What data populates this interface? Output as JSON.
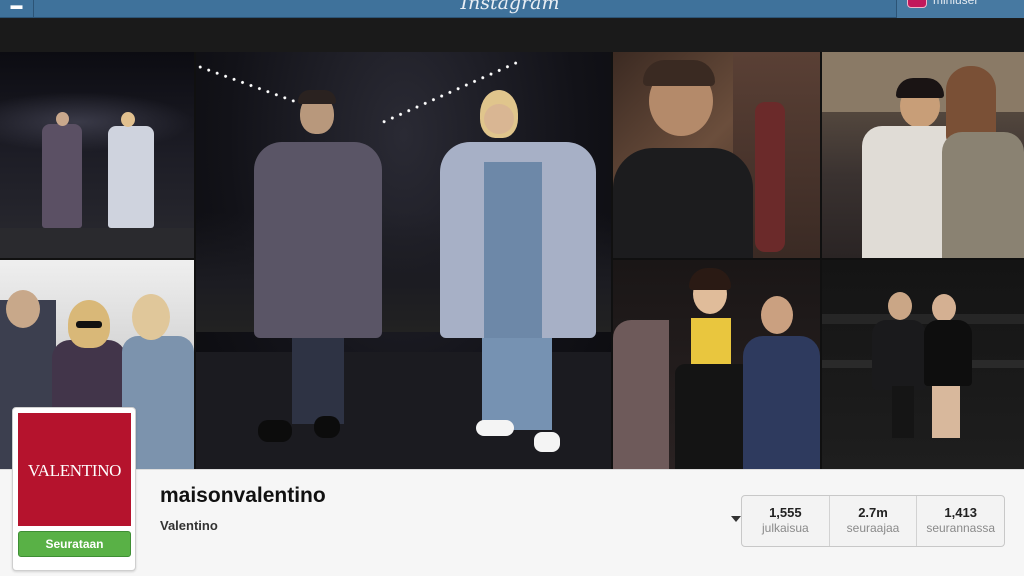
{
  "topbar": {
    "logo_text": "Instagram",
    "menu_icon": "menu-icon",
    "username": "miniuser"
  },
  "profile": {
    "username": "maisonvalentino",
    "full_name": "Valentino",
    "avatar_text": "VALENTINO",
    "follow_label": "Seurataan",
    "stats": [
      {
        "value": "1,555",
        "label": "julkaisua"
      },
      {
        "value": "2.7m",
        "label": "seuraajaa"
      },
      {
        "value": "1,413",
        "label": "seurannassa"
      }
    ]
  },
  "photos": [
    "runway-two-models",
    "selfie-three-people",
    "runway-two-models-large",
    "man-leather-jacket",
    "two-guests-front-row",
    "front-row-guests",
    "man-woman-seated"
  ],
  "colors": {
    "topbar": "#3f729b",
    "brand_red": "#b5132d",
    "follow_green": "#59b146"
  }
}
